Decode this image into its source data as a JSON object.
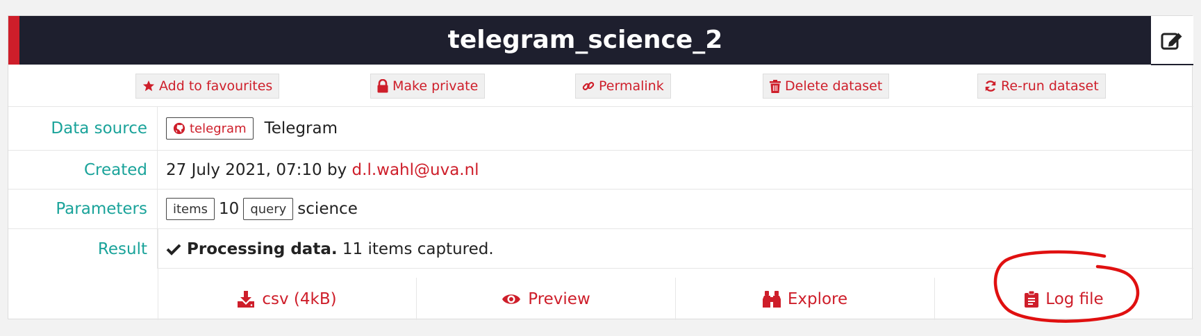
{
  "dataset": {
    "title": "telegram_science_2"
  },
  "actions": {
    "favourite": "Add to favourites",
    "private": "Make private",
    "permalink": "Permalink",
    "delete": "Delete dataset",
    "rerun": "Re-run dataset"
  },
  "rows": {
    "source": {
      "label": "Data source",
      "tag": "telegram",
      "value": "Telegram"
    },
    "created": {
      "label": "Created",
      "date": "27 July 2021, 07:10 by ",
      "author": "d.l.wahl@uva.nl"
    },
    "parameters": {
      "label": "Parameters",
      "p1_key": "items",
      "p1_value": "10",
      "p2_key": "query",
      "p2_value": "science"
    },
    "result": {
      "label": "Result",
      "status_bold": "Processing data.",
      "status_rest": " 11 items captured."
    }
  },
  "downloads": {
    "csv": "csv (4kB)",
    "preview": "Preview",
    "explore": "Explore",
    "log": "Log file"
  },
  "colors": {
    "accent": "#ce1e2a",
    "label": "#1aa39a",
    "header_bg": "#1e1f2e"
  }
}
